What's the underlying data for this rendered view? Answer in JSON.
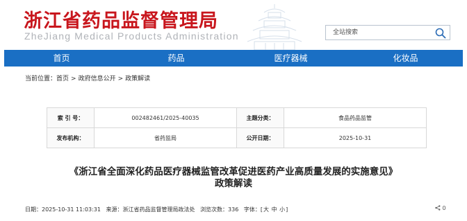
{
  "header": {
    "logo_cn": "浙江省药品监督管理局",
    "logo_en": "ZheJiang Medical Products Administration",
    "search_placeholder": "全站搜索"
  },
  "nav": {
    "items": [
      "首页",
      "药品",
      "医疗器械",
      "化妆品"
    ]
  },
  "breadcrumb": {
    "prefix": "当前位置：",
    "items": [
      "首页",
      "政府信息公开",
      "政策解读"
    ],
    "separator": ">"
  },
  "info": {
    "index_label": "索 引 号：",
    "index_value": "002482461/2025-40035",
    "category_label": "主题分类：",
    "category_value": "食品药品监管",
    "issuer_label": "发布机构：",
    "issuer_value": "省药监局",
    "date_label": "公开日期：",
    "date_value": "2025-10-31"
  },
  "article": {
    "title_line1": "《浙江省全面深化药品医疗器械监管改革促进医药产业高质量发展的实施意见》",
    "title_line2": "政策解读"
  },
  "meta": {
    "date": "日期：2025-10-31 11:03:31",
    "source": "来源：浙江省药品监督管理局政法处",
    "views": "浏览次数：336",
    "fontsize_label": "字体：[",
    "fs_large": "大",
    "fs_medium": "中",
    "fs_small": "小",
    "fontsize_close": "]",
    "share_count": "0"
  },
  "colors": {
    "brand_red": "#c8161d",
    "nav_blue": "#1a6fc4"
  }
}
